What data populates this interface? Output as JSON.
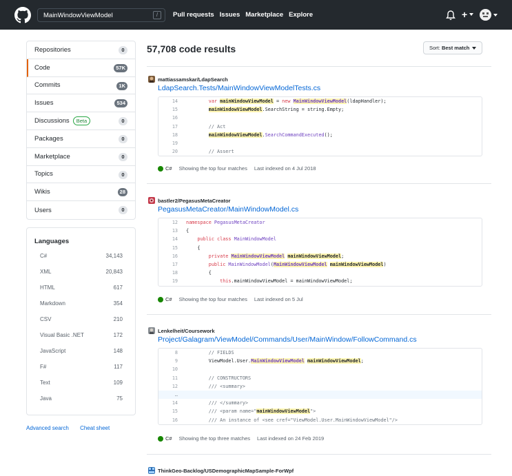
{
  "header": {
    "search_value": "MainWindowViewModel",
    "slash_key": "/",
    "nav": [
      "Pull requests",
      "Issues",
      "Marketplace",
      "Explore"
    ],
    "plus_label": "+"
  },
  "sidebar": {
    "menu": [
      {
        "label": "Repositories",
        "count": "0",
        "dark": false
      },
      {
        "label": "Code",
        "count": "57K",
        "dark": true,
        "selected": true
      },
      {
        "label": "Commits",
        "count": "1K",
        "dark": true
      },
      {
        "label": "Issues",
        "count": "534",
        "dark": true
      },
      {
        "label": "Discussions",
        "count": "0",
        "dark": false,
        "badge": "Beta"
      },
      {
        "label": "Packages",
        "count": "0",
        "dark": false
      },
      {
        "label": "Marketplace",
        "count": "0",
        "dark": false
      },
      {
        "label": "Topics",
        "count": "0",
        "dark": false
      },
      {
        "label": "Wikis",
        "count": "28",
        "dark": true
      },
      {
        "label": "Users",
        "count": "0",
        "dark": false
      }
    ],
    "languages_title": "Languages",
    "languages": [
      {
        "name": "C#",
        "count": "34,143"
      },
      {
        "name": "XML",
        "count": "20,843"
      },
      {
        "name": "HTML",
        "count": "617"
      },
      {
        "name": "Markdown",
        "count": "354"
      },
      {
        "name": "CSV",
        "count": "210"
      },
      {
        "name": "Visual Basic .NET",
        "count": "172"
      },
      {
        "name": "JavaScript",
        "count": "148"
      },
      {
        "name": "F#",
        "count": "117"
      },
      {
        "name": "Text",
        "count": "109"
      },
      {
        "name": "Java",
        "count": "75"
      }
    ],
    "advanced_search": "Advanced search",
    "cheat_sheet": "Cheat sheet"
  },
  "results": {
    "title": "57,708 code results",
    "sort_prefix": "Sort:",
    "sort_value": "Best match",
    "items": [
      {
        "repo": "mattiassamskar/LdapSearch",
        "file": "LdapSearch.Tests/MainWindowViewModelTests.cs",
        "lang": "C#",
        "matches": "Showing the top four matches",
        "indexed": "Last indexed on 4 Jul 2018"
      },
      {
        "repo": "bastler2/PegasusMetaCreator",
        "file": "PegasusMetaCreator/MainWindowModel.cs",
        "lang": "C#",
        "matches": "Showing the top four matches",
        "indexed": "Last indexed on 5 Jul"
      },
      {
        "repo": "Lenkelheit/Coursework",
        "file": "Project/Galagram/ViewModel/Commands/User/MainWindow/FollowCommand.cs",
        "lang": "C#",
        "matches": "Showing the top three matches",
        "indexed": "Last indexed on 24 Feb 2019"
      },
      {
        "repo": "ThinkGeo-Backlog/USDemographicMapSample-ForWpf"
      }
    ]
  },
  "colors": {
    "header_bg": "#24292e",
    "link": "#0366d6",
    "highlight": "#fff5b1",
    "csharp": "#178600",
    "selected_border": "#e36209"
  }
}
